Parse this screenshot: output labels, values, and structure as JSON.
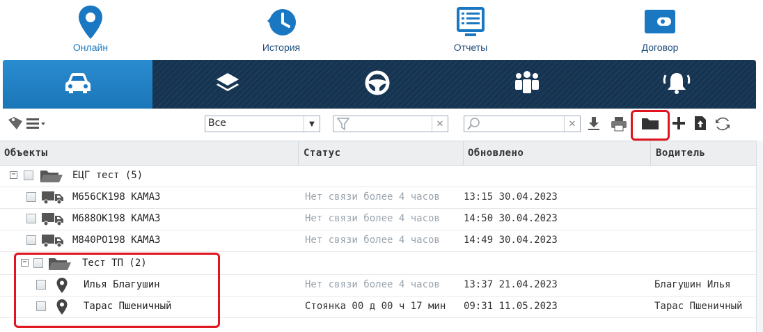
{
  "nav": {
    "tabs": [
      {
        "label": "Онлайн",
        "icon": "map-pin-icon",
        "active": true
      },
      {
        "label": "История",
        "icon": "history-icon",
        "active": false
      },
      {
        "label": "Отчеты",
        "icon": "report-list-icon",
        "active": false
      },
      {
        "label": "Договор",
        "icon": "wallet-icon",
        "active": false
      }
    ]
  },
  "iconbar": {
    "items": [
      "car-icon",
      "layers-icon",
      "steering-wheel-icon",
      "people-icon",
      "alarm-bell-icon"
    ]
  },
  "toolbar": {
    "filter_select_value": "Все",
    "filter_field_value": "",
    "search_field_value": "",
    "icons": [
      "tag-icon",
      "menu-icon",
      "download-icon",
      "print-icon",
      "folder-icon",
      "add-icon",
      "upload-file-icon",
      "refresh-icon"
    ]
  },
  "table": {
    "headers": {
      "objects": "Объекты",
      "status": "Статус",
      "updated": "Обновлено",
      "driver": "Водитель"
    },
    "rows": [
      {
        "type": "group",
        "name": "ЕЦГ тест (5)",
        "status": "",
        "updated": "",
        "driver": ""
      },
      {
        "type": "truck",
        "name": "М656СК198 КАМАЗ",
        "status": "Нет связи более 4 часов",
        "updated": "13:15 30.04.2023",
        "driver": ""
      },
      {
        "type": "truck",
        "name": "М688ОК198 КАМАЗ",
        "status": "Нет связи более 4 часов",
        "updated": "14:50 30.04.2023",
        "driver": ""
      },
      {
        "type": "truck",
        "name": "М840РО198 КАМАЗ",
        "status": "Нет связи более 4 часов",
        "updated": "14:49 30.04.2023",
        "driver": ""
      },
      {
        "type": "group",
        "name": "Тест ТП (2)",
        "status": "",
        "updated": "",
        "driver": ""
      },
      {
        "type": "person",
        "name": "Илья Благушин",
        "status": "Нет связи более 4 часов",
        "updated": "13:37 21.04.2023",
        "driver": "Благушин Илья"
      },
      {
        "type": "person",
        "name": "Тарас Пшеничный",
        "status": "Стоянка 00 д 00 ч 17 мин",
        "updated": "09:31 11.05.2023",
        "driver": "Тарас Пшеничный"
      }
    ]
  },
  "colors": {
    "accent": "#1a78c2",
    "nav_dark": "#1b3c5a",
    "highlight": "#e0141e"
  }
}
